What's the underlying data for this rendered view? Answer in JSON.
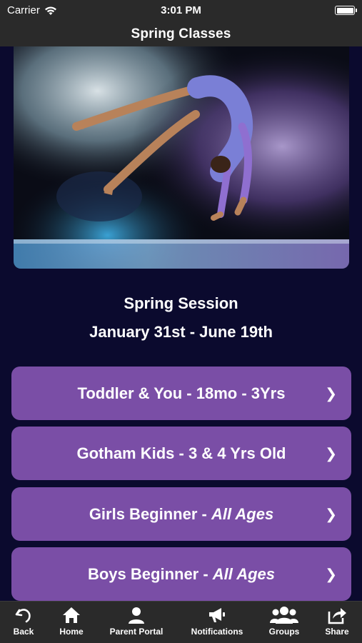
{
  "status_bar": {
    "carrier": "Carrier",
    "time": "3:01 PM"
  },
  "nav": {
    "title": "Spring Classes"
  },
  "session": {
    "title": "Spring Session",
    "dates": "January 31st - June 19th"
  },
  "classes": [
    {
      "label": "Toddler & You - 18mo - 3Yrs",
      "suffix": ""
    },
    {
      "label": "Gotham Kids - 3 & 4 Yrs Old",
      "suffix": ""
    },
    {
      "label": "Girls Beginner - ",
      "suffix": "All Ages"
    },
    {
      "label": "Boys Beginner - ",
      "suffix": "All Ages"
    }
  ],
  "chevron": "❯",
  "tabs": [
    {
      "label": "Back",
      "icon": "back-icon"
    },
    {
      "label": "Home",
      "icon": "home-icon"
    },
    {
      "label": "Parent Portal",
      "icon": "person-icon"
    },
    {
      "label": "Notifications",
      "icon": "megaphone-icon"
    },
    {
      "label": "Groups",
      "icon": "groups-icon"
    },
    {
      "label": "Share",
      "icon": "share-icon"
    }
  ],
  "colors": {
    "background": "#0b0a2e",
    "bars": "#2a2a2a",
    "button": "#7a4ea6"
  }
}
